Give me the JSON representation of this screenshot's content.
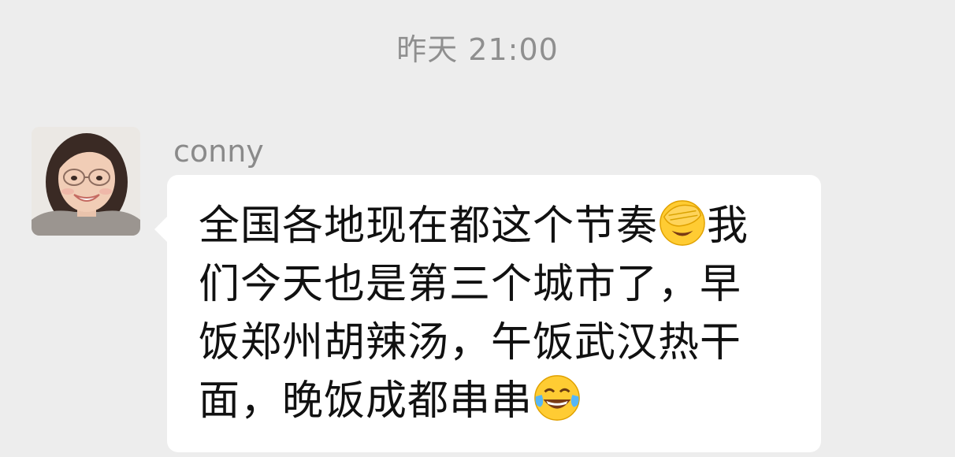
{
  "chat": {
    "timestamp": "昨天 21:00",
    "message": {
      "sender": "conny",
      "lines": [
        "全国各地现在都这个节奏",
        "我",
        "们今天也是第三个城市了，早",
        "饭郑州胡辣汤，午饭武汉热干",
        "面，晚饭成都串串"
      ],
      "emojis": [
        "facepalm-emoji",
        "tears-of-joy-emoji"
      ]
    }
  },
  "colors": {
    "background": "#ededed",
    "bubble": "#ffffff",
    "timestamp_text": "#8f8f8f",
    "sender_text": "#8a8a8a",
    "message_text": "#111111"
  }
}
